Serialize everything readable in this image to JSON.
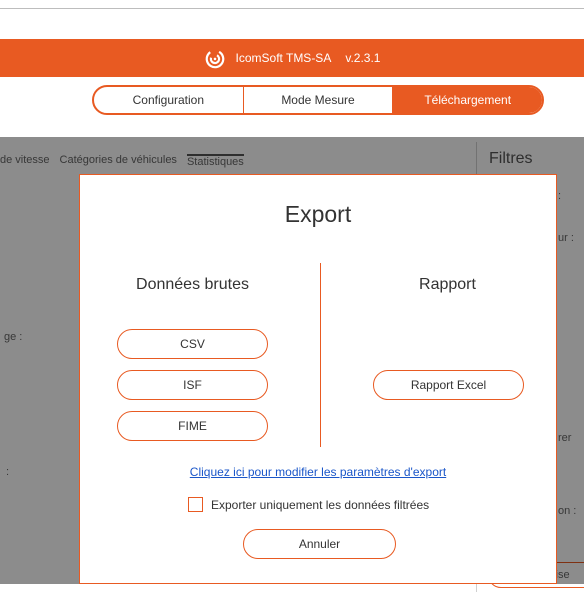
{
  "app": {
    "title": "IcomSoft TMS-SA",
    "version": "v.2.3.1",
    "header_color": "#e85a22",
    "logo_icon": "signal-logo-icon"
  },
  "nav": {
    "tabs": [
      {
        "label": "Configuration",
        "active": false
      },
      {
        "label": "Mode Mesure",
        "active": false
      },
      {
        "label": "Téléchargement",
        "active": true
      }
    ]
  },
  "background": {
    "tabs": [
      "de vitesse",
      "Catégories de véhicules",
      "Statistiques"
    ],
    "filters_title": "Filtres",
    "side_labels": [
      ":",
      "ur :",
      "ge :",
      ":",
      "rer",
      "on :"
    ],
    "reset_label": "Réinitialise"
  },
  "dialog": {
    "title": "Export",
    "raw_data": {
      "title": "Données brutes",
      "buttons": [
        "CSV",
        "ISF",
        "FIME"
      ]
    },
    "report": {
      "title": "Rapport",
      "buttons": [
        "Rapport Excel"
      ]
    },
    "settings_link": "Cliquez ici pour modifier les paramètres d'export",
    "filtered_only_label": "Exporter uniquement les données filtrées",
    "filtered_only_checked": false,
    "cancel_label": "Annuler"
  }
}
